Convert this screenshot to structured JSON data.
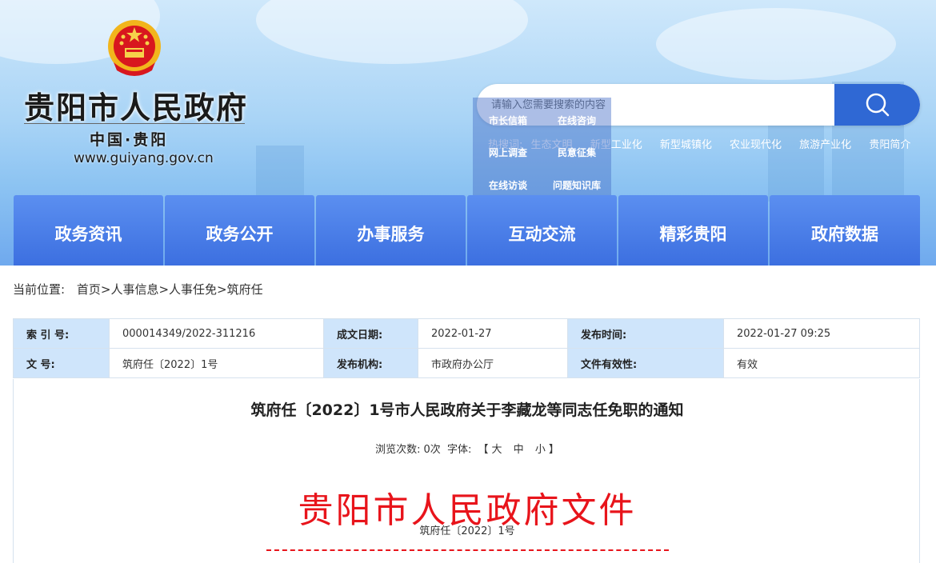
{
  "header": {
    "site_name": "贵阳市人民政府",
    "site_sub": "中国·贵阳",
    "site_url": "www.guiyang.gov.cn",
    "search_placeholder": "请输入您需要搜索的内容",
    "hot_label": "热搜词:",
    "hot_words": [
      "生态文明",
      "新型工业化",
      "新型城镇化",
      "农业现代化",
      "旅游产业化",
      "贵阳简介"
    ],
    "dropdown": [
      "市长信箱",
      "在线咨询",
      "网上调查",
      "民意征集",
      "在线访谈",
      "问题知识库"
    ]
  },
  "nav": [
    "政务资讯",
    "政务公开",
    "办事服务",
    "互动交流",
    "精彩贵阳",
    "政府数据"
  ],
  "breadcrumb": {
    "label": "当前位置:",
    "items": [
      "首页",
      "人事信息",
      "人事任免",
      "筑府任"
    ],
    "sep": ">"
  },
  "info": {
    "row1": [
      {
        "k": "索 引 号:",
        "v": "000014349/2022-311216"
      },
      {
        "k": "成文日期:",
        "v": "2022-01-27"
      },
      {
        "k": "发布时间:",
        "v": "2022-01-27 09:25"
      }
    ],
    "row2": [
      {
        "k": "文 号:",
        "v": "筑府任〔2022〕1号"
      },
      {
        "k": "发布机构:",
        "v": "市政府办公厅"
      },
      {
        "k": "文件有效性:",
        "v": "有效"
      }
    ]
  },
  "article": {
    "title": "筑府任〔2022〕1号市人民政府关于李藏龙等同志任免职的通知",
    "views_label": "浏览次数:",
    "views": "0次",
    "font_label": "字体:",
    "font_open": "【",
    "font_large": "大",
    "font_medium": "中",
    "font_small": "小",
    "font_close": "】",
    "doc_head": "贵阳市人民政府文件",
    "doc_num": "筑府任〔2022〕1号"
  },
  "colors": {
    "nav_bg": "#3c6fe0",
    "search_btn": "#2f68d4",
    "table_key_bg": "#cfe5fb",
    "doc_red": "#e8141b"
  },
  "icons": [
    "national-emblem-icon",
    "search-icon"
  ]
}
